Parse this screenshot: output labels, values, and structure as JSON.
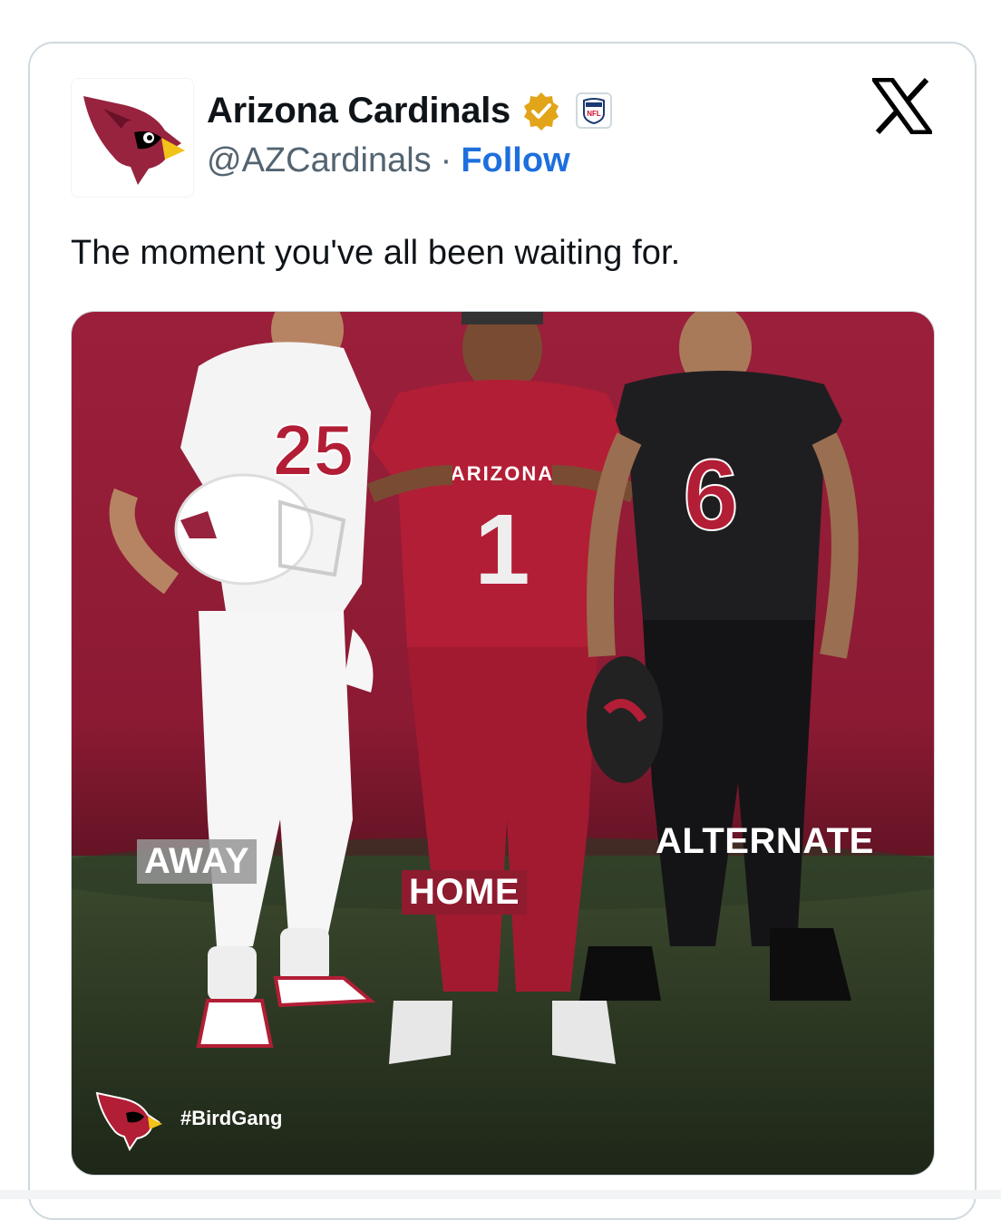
{
  "author": {
    "name": "Arizona Cardinals",
    "handle": "@AZCardinals",
    "separator": "·",
    "follow_label": "Follow",
    "verified_icon": "gold-verified-badge-icon",
    "affiliate_badge": "NFL"
  },
  "platform_icon": "x-logo-icon",
  "tweet": {
    "text": "The moment you've all been waiting for."
  },
  "media": {
    "labels": {
      "away": "AWAY",
      "home": "HOME",
      "alternate": "ALTERNATE"
    },
    "jersey_numbers": [
      "25",
      "1",
      "6"
    ],
    "jersey_text": "ARIZONA",
    "hashtag": "#BirdGang"
  },
  "colors": {
    "brand_red": "#97233f",
    "link_blue": "#1d6fde",
    "text": "#0f1419",
    "muted": "#536471"
  }
}
